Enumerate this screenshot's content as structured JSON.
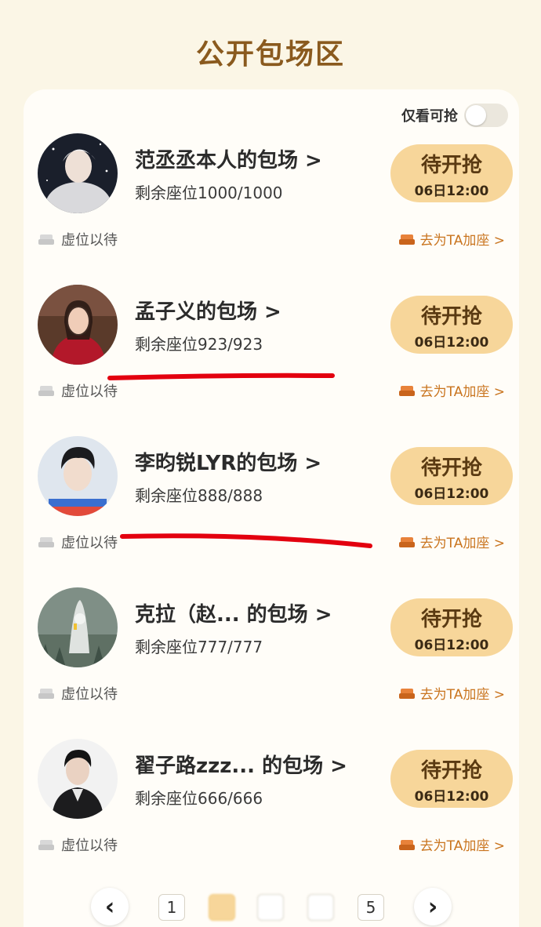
{
  "page_title": "公开包场区",
  "filter": {
    "label": "仅看可抢",
    "enabled": false
  },
  "colors": {
    "accent": "#f7d69a",
    "title": "#8a5a1e",
    "link": "#c9741e",
    "annotation": "#e3000f"
  },
  "items": [
    {
      "title": "范丞丞本人的包场 >",
      "seats": "剩余座位1000/1000",
      "button": "待开抢",
      "time": "06日12:00",
      "wait": "虚位以待",
      "link": "去为TA加座 >"
    },
    {
      "title": "孟子义的包场 >",
      "seats": "剩余座位923/923",
      "button": "待开抢",
      "time": "06日12:00",
      "wait": "虚位以待",
      "link": "去为TA加座 >"
    },
    {
      "title": "李昀锐LYR的包场 >",
      "seats": "剩余座位888/888",
      "button": "待开抢",
      "time": "06日12:00",
      "wait": "虚位以待",
      "link": "去为TA加座 >"
    },
    {
      "title": "克拉（赵... 的包场 >",
      "seats": "剩余座位777/777",
      "button": "待开抢",
      "time": "06日12:00",
      "wait": "虚位以待",
      "link": "去为TA加座 >"
    },
    {
      "title": "翟子路zzz... 的包场 >",
      "seats": "剩余座位666/666",
      "button": "待开抢",
      "time": "06日12:00",
      "wait": "虚位以待",
      "link": "去为TA加座 >"
    }
  ],
  "pagination": {
    "prev": "‹",
    "next": "›",
    "first": "1",
    "last": "5",
    "current_page": 2
  }
}
